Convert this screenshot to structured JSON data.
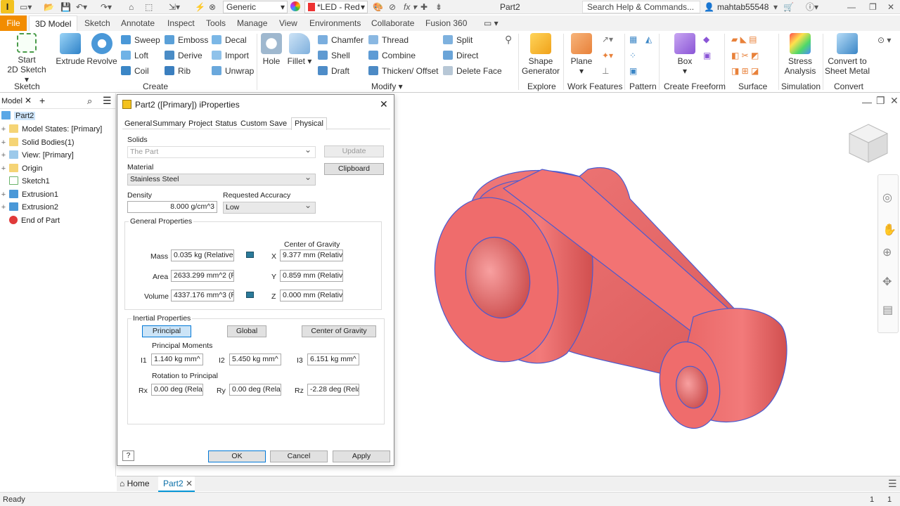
{
  "qat": {
    "appearance_value": "Generic",
    "material_value": "*LED - Red",
    "doc_title": "Part2",
    "search_placeholder": "Search Help & Commands...",
    "user": "mahtab55548"
  },
  "tabs": [
    "File",
    "3D Model",
    "Sketch",
    "Annotate",
    "Inspect",
    "Tools",
    "Manage",
    "View",
    "Environments",
    "Collaborate",
    "Fusion 360"
  ],
  "ribbon": {
    "start_sketch": [
      "Start",
      "2D Sketch"
    ],
    "extrude": "Extrude",
    "revolve": "Revolve",
    "sweep": "Sweep",
    "loft": "Loft",
    "coil": "Coil",
    "emboss": "Emboss",
    "derive": "Derive",
    "rib": "Rib",
    "decal": "Decal",
    "import": "Import",
    "unwrap": "Unwrap",
    "hole": "Hole",
    "fillet": "Fillet",
    "chamfer": "Chamfer",
    "shell": "Shell",
    "draft": "Draft",
    "thread": "Thread",
    "combine": "Combine",
    "thicken": "Thicken/ Offset",
    "split": "Split",
    "direct": "Direct",
    "delete_face": "Delete Face",
    "shape_generator": [
      "Shape",
      "Generator"
    ],
    "plane": "Plane",
    "box": "Box",
    "stress": [
      "Stress",
      "Analysis"
    ],
    "convert": [
      "Convert to",
      "Sheet Metal"
    ],
    "groups": {
      "sketch": "Sketch",
      "create": "Create",
      "modify": "Modify",
      "explore": "Explore",
      "work": "Work Features",
      "pattern": "Pattern",
      "freeform": "Create Freeform",
      "surface": "Surface",
      "simulation": "Simulation",
      "convert": "Convert"
    }
  },
  "browser": {
    "tab": "Model",
    "items": [
      "Part2",
      "Model States: [Primary]",
      "Solid Bodies(1)",
      "View: [Primary]",
      "Origin",
      "Sketch1",
      "Extrusion1",
      "Extrusion2",
      "End of Part"
    ]
  },
  "dialog": {
    "title": "Part2 ([Primary]) iProperties",
    "tabs": [
      "General",
      "Summary",
      "Project",
      "Status",
      "Custom",
      "Save",
      "Physical"
    ],
    "solids_label": "Solids",
    "solids_value": "The Part",
    "update": "Update",
    "clipboard": "Clipboard",
    "material_label": "Material",
    "material_value": "Stainless Steel",
    "density_label": "Density",
    "density_value": "8.000 g/cm^3",
    "accuracy_label": "Requested Accuracy",
    "accuracy_value": "Low",
    "general_props": "General Properties",
    "cog_label": "Center of Gravity",
    "mass_label": "Mass",
    "mass_value": "0.035 kg (Relative",
    "area_label": "Area",
    "area_value": "2633.299 mm^2 (R",
    "volume_label": "Volume",
    "volume_value": "4337.176 mm^3 (R",
    "x_label": "X",
    "x_value": "9.377 mm (Relative",
    "y_label": "Y",
    "y_value": "0.859 mm (Relative",
    "z_label": "Z",
    "z_value": "0.000 mm (Relative",
    "inertial_props": "Inertial Properties",
    "principal": "Principal",
    "global": "Global",
    "center_of_gravity": "Center of Gravity",
    "principal_moments": "Principal Moments",
    "i1_label": "I1",
    "i1_value": "1.140 kg mm^",
    "i2_label": "I2",
    "i2_value": "5.450 kg mm^",
    "i3_label": "I3",
    "i3_value": "6.151 kg mm^",
    "rotation_label": "Rotation to Principal",
    "rx_label": "Rx",
    "rx_value": "0.00 deg (Relat",
    "ry_label": "Ry",
    "ry_value": "0.00 deg (Relat",
    "rz_label": "Rz",
    "rz_value": "-2.28 deg (Rela",
    "ok": "OK",
    "cancel": "Cancel",
    "apply": "Apply"
  },
  "doctabs": {
    "home": "Home",
    "part": "Part2"
  },
  "status": {
    "text": "Ready",
    "a": "1",
    "b": "1"
  },
  "colors": {
    "part": "#f26b6b",
    "accent": "#f28c00",
    "selection": "#cfe6fb"
  }
}
